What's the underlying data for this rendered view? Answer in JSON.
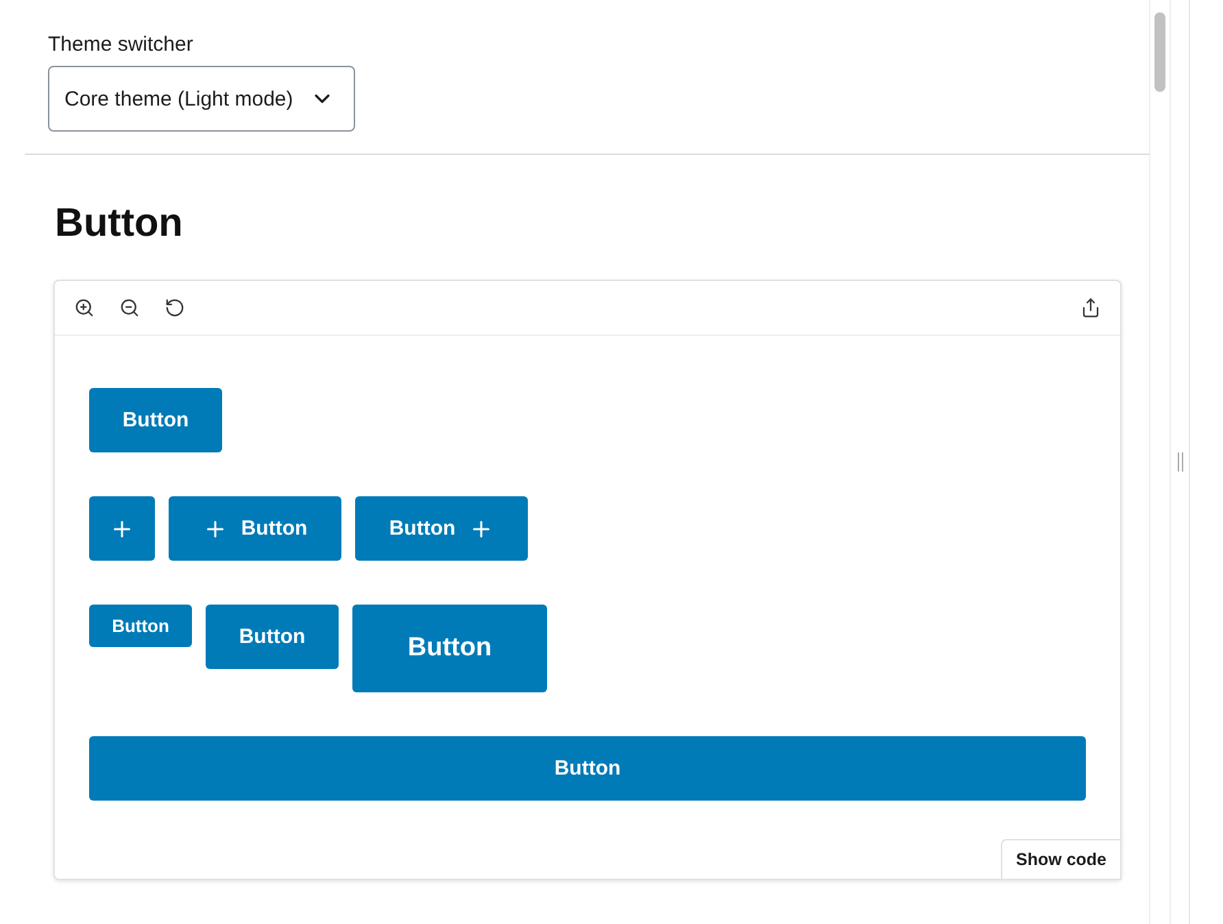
{
  "theme_switcher": {
    "label": "Theme switcher",
    "value": "Core theme (Light mode)"
  },
  "heading": "Button",
  "preview": {
    "toolbar": {
      "left": [
        {
          "kind": "zoom-in"
        },
        {
          "kind": "zoom-out"
        },
        {
          "kind": "reset-zoom"
        }
      ],
      "right": [
        {
          "kind": "share"
        }
      ]
    },
    "rows": [
      {
        "buttons": [
          {
            "kind": "medium",
            "label": "Button"
          }
        ]
      },
      {
        "buttons": [
          {
            "kind": "icon-only"
          },
          {
            "kind": "icon-left",
            "label": "Button"
          },
          {
            "kind": "icon-right",
            "label": "Button"
          }
        ]
      },
      {
        "buttons": [
          {
            "kind": "small",
            "label": "Button"
          },
          {
            "kind": "medium",
            "label": "Button"
          },
          {
            "kind": "large",
            "label": "Button"
          }
        ]
      },
      {
        "buttons": [
          {
            "kind": "full-width",
            "label": "Button"
          }
        ]
      }
    ],
    "show_code": "Show code"
  }
}
